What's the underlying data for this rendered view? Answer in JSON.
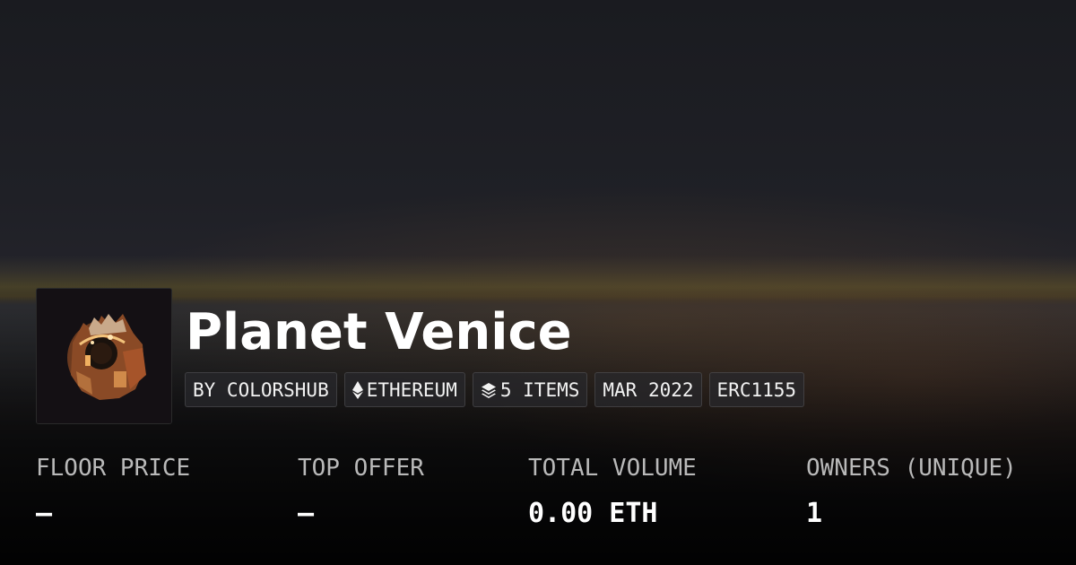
{
  "collection": {
    "title": "Planet Venice",
    "tags": [
      {
        "icon": "none",
        "label": "BY COLORSHUB"
      },
      {
        "icon": "ethereum-icon",
        "label": "ETHEREUM"
      },
      {
        "icon": "layers-icon",
        "label": "5 ITEMS"
      },
      {
        "icon": "none",
        "label": "MAR 2022"
      },
      {
        "icon": "none",
        "label": "ERC1155"
      }
    ]
  },
  "stats": [
    {
      "label": "FLOOR PRICE",
      "value": "–"
    },
    {
      "label": "TOP OFFER",
      "value": "–"
    },
    {
      "label": "TOTAL VOLUME",
      "value": "0.00 ETH"
    },
    {
      "label": "OWNERS (UNIQUE)",
      "value": "1"
    }
  ]
}
